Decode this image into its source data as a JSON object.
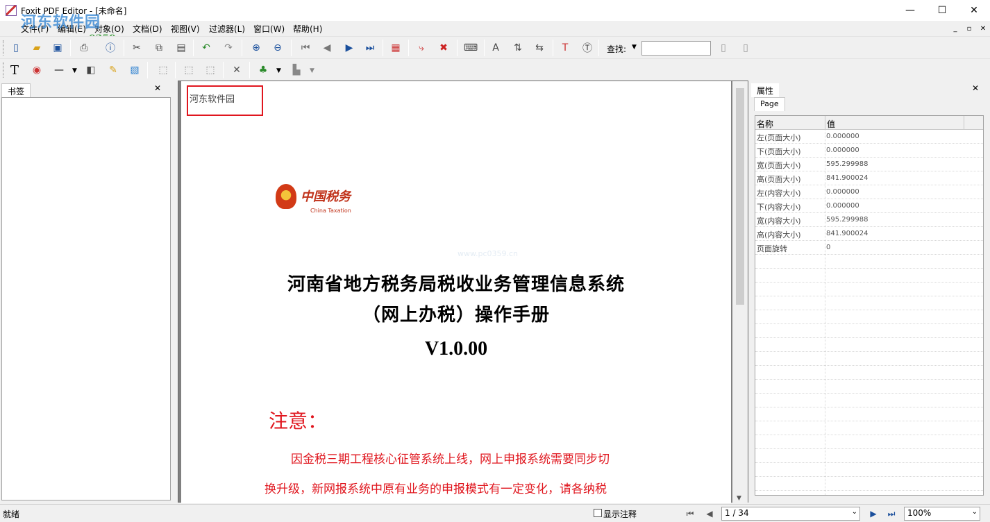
{
  "window": {
    "title": "Foxit PDF Editor - [未命名]",
    "minimize": "—",
    "maximize": "☐",
    "close": "✕"
  },
  "watermark": {
    "text": "河东软件园",
    "url": "www.pc0359.cn"
  },
  "menu": [
    "文件(F)",
    "编辑(E)",
    "对象(O)",
    "文档(D)",
    "视图(V)",
    "过滤器(L)",
    "窗口(W)",
    "帮助(H)"
  ],
  "mdi_controls": {
    "minimize": "_",
    "restore": "▫",
    "close": "✕"
  },
  "search": {
    "label": "查找:",
    "value": ""
  },
  "bookmark_pane": {
    "tab": "书签",
    "close": "✕"
  },
  "document": {
    "annotation_text": "河东软件园",
    "logo_text": "中国税务",
    "logo_sub": "China Taxation",
    "page_watermark": "www.pc0359.cn",
    "title_line1": "河南省地方税务局税收业务管理信息系统",
    "title_line2": "（网上办税）操作手册",
    "version": "V1.0.00",
    "notice_heading": "注意：",
    "notice_line1": "因金税三期工程核心征管系统上线，网上申报系统需要同步切",
    "notice_line2": "换升级，新网报系统中原有业务的申报模式有一定变化，请各纳税"
  },
  "properties": {
    "pane_title": "属性",
    "tab": "Page",
    "close": "✕",
    "col_name": "名称",
    "col_value": "值",
    "rows": [
      {
        "name": "左(页面大小)",
        "value": "0.000000"
      },
      {
        "name": "下(页面大小)",
        "value": "0.000000"
      },
      {
        "name": "宽(页面大小)",
        "value": "595.299988"
      },
      {
        "name": "高(页面大小)",
        "value": "841.900024"
      },
      {
        "name": "左(内容大小)",
        "value": "0.000000"
      },
      {
        "name": "下(内容大小)",
        "value": "0.000000"
      },
      {
        "name": "宽(内容大小)",
        "value": "595.299988"
      },
      {
        "name": "高(内容大小)",
        "value": "841.900024"
      },
      {
        "name": "页面旋转",
        "value": "0"
      }
    ]
  },
  "status": {
    "text": "就绪",
    "show_annotations": "显示注释",
    "page_indicator": "1 / 34",
    "zoom": "100%"
  },
  "colors": {
    "annotation_box": "#e0161e",
    "notice_red": "#e0161e",
    "accent": "#1a4f9c"
  }
}
